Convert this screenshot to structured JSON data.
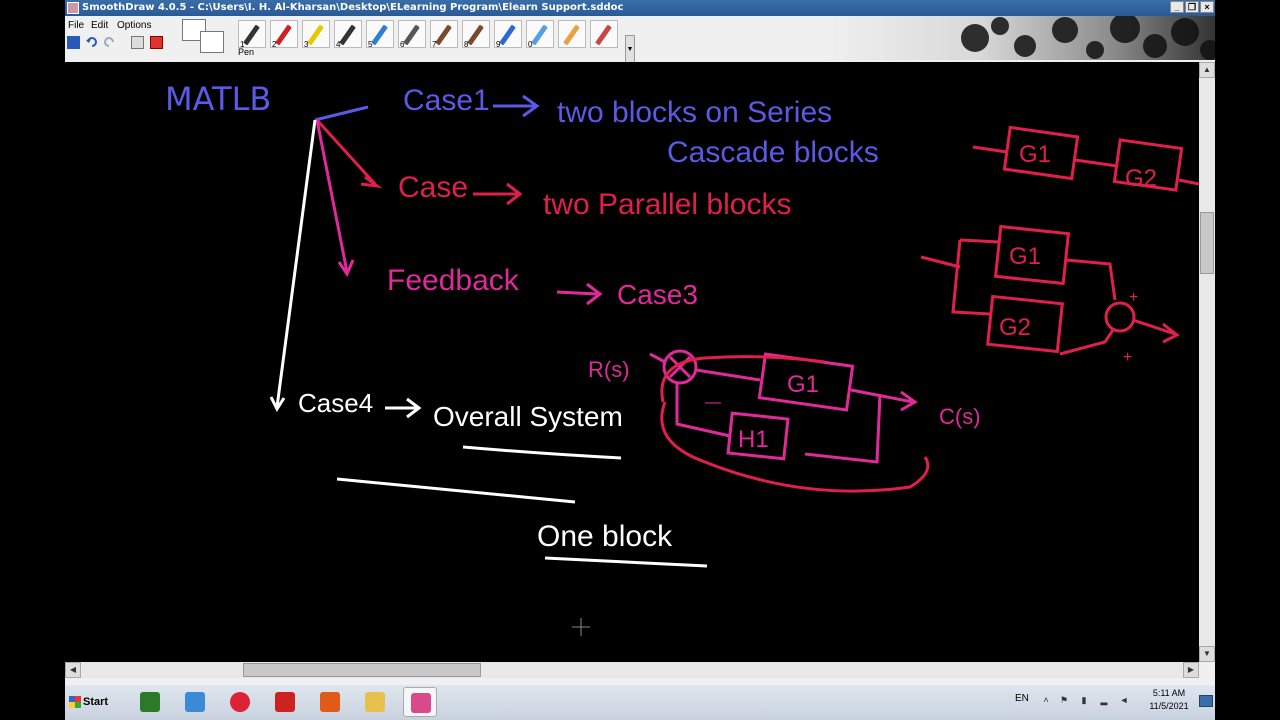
{
  "window": {
    "title": "SmoothDraw 4.0.5 - C:\\Users\\I. H. Al-Kharsan\\Desktop\\ELearning Program\\Elearn Support.sddoc",
    "controls": {
      "minimize": "_",
      "restore": "❐",
      "close": "×"
    }
  },
  "menu": {
    "file": "File",
    "edit": "Edit",
    "options": "Options"
  },
  "toolbar": {
    "pen_label": "Pen",
    "tools": [
      {
        "num": "1",
        "color": "#333333"
      },
      {
        "num": "2",
        "color": "#cc2222"
      },
      {
        "num": "3",
        "color": "#e6c800"
      },
      {
        "num": "4",
        "color": "#333333"
      },
      {
        "num": "5",
        "color": "#2e7fd1"
      },
      {
        "num": "6",
        "color": "#555555"
      },
      {
        "num": "7",
        "color": "#7a4a2a"
      },
      {
        "num": "8",
        "color": "#7a4a2a"
      },
      {
        "num": "9",
        "color": "#2a6ad1"
      },
      {
        "num": "0",
        "color": "#55a0e0"
      },
      {
        "num": "",
        "color": "#e8a040"
      },
      {
        "num": "",
        "color": "#cc4444"
      }
    ]
  },
  "canvas": {
    "colors": {
      "blue": "#5a5ae6",
      "red": "#e0204a",
      "pink": "#e02a9a",
      "white": "#ffffff"
    },
    "text": {
      "matlab": "MATLB",
      "case1": "Case1",
      "case1_desc": "two blocks on Series",
      "case1_desc2": "Cascade blocks",
      "case2": "Case",
      "case2_desc": "two Parallel blocks",
      "feedback": "Feedback",
      "case3": "Case3",
      "case4": "Case4",
      "overall": "Overall System",
      "one_block": "One block",
      "g1": "G1",
      "g2": "G2",
      "h1": "H1",
      "rs": "R(s)",
      "cs": "C(s)",
      "plus": "+",
      "minus": "—"
    }
  },
  "taskbar": {
    "start_label": "Start",
    "lang": "EN",
    "time": "5:11 AM",
    "date": "11/5/2021",
    "apps": [
      {
        "icon": "excel-icon",
        "color": "#2a7a2a"
      },
      {
        "icon": "chat-icon",
        "color": "#3a8ad8"
      },
      {
        "icon": "chrome-icon",
        "color": "#d23"
      },
      {
        "icon": "pdf-icon",
        "color": "#c22"
      },
      {
        "icon": "matlab-icon",
        "color": "#e05a1a"
      },
      {
        "icon": "folder-icon",
        "color": "#e8c050"
      },
      {
        "icon": "smoothdraw-icon",
        "color": "#d84a8a"
      }
    ]
  }
}
